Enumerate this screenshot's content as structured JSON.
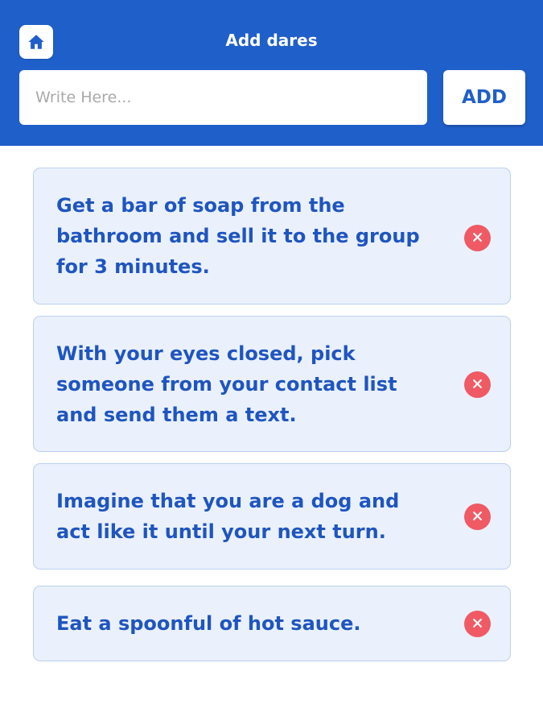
{
  "header": {
    "title": "Add dares",
    "home_icon": "home-icon",
    "background_color": "#1f5fc9"
  },
  "input": {
    "placeholder": "Write Here...",
    "value": ""
  },
  "add_button": {
    "label": "ADD"
  },
  "dares": [
    {
      "text": "Get a bar of soap from the bathroom and sell it to the group for 3 minutes.",
      "delete_icon": "close-circle-icon"
    },
    {
      "text": "With your eyes closed, pick someone from your contact list and send them a text.",
      "delete_icon": "close-circle-icon"
    },
    {
      "text": "Imagine that you are a dog and act like it until your next turn.",
      "delete_icon": "close-circle-icon"
    },
    {
      "text": "Eat a spoonful of hot sauce.",
      "delete_icon": "close-circle-icon"
    }
  ],
  "colors": {
    "accent": "#1f5fc9",
    "card_background": "#eaf1fd",
    "delete": "#ef5a64"
  }
}
